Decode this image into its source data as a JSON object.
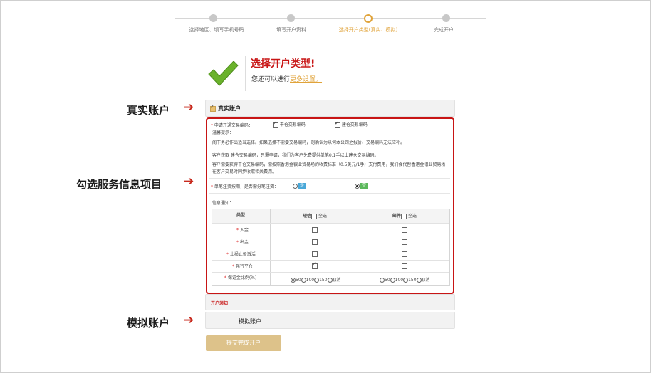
{
  "steps": [
    {
      "label": "选择地区、填写手机号码",
      "active": false
    },
    {
      "label": "填写开户资料",
      "active": false
    },
    {
      "label": "选择开户类型(真实、模拟)",
      "active": true
    },
    {
      "label": "完成开户",
      "active": false
    }
  ],
  "heading": {
    "title": "选择开户类型!",
    "subtitle_prefix": "您还可以进行",
    "subtitle_link": "更多设置。"
  },
  "side_labels": {
    "real": "真实账户",
    "services": "勾选服务信息项目",
    "demo": "模拟账户"
  },
  "real_account": {
    "label": "真实账户",
    "apply_label": "申请开通交易编码：",
    "codes": [
      {
        "label": "平仓交易编码",
        "checked": true
      },
      {
        "label": "建仓交易编码",
        "checked": true
      }
    ],
    "tips_title": "温馨提示：",
    "tips": [
      "阁下务必作出适当选择。如果选择不需要交易编码，则确认为以何本公司之报价、交易编码无法应补。",
      "客户获取 建仓交易编码，只需申请，我们为客户免费提供单笔0.1手以上建仓交易编码。",
      "客户需要获得平仓交易编码，需按照香港金银业贸易场的收费标准（0.5美元/1手）支付费用，我们会代替香港金银业贸易场在客户交易时同步收取相关费用。"
    ],
    "register_question": "单笔注资按期，是否需分笔注资：",
    "register_options": [
      {
        "label": "是",
        "selected": false,
        "color": "#4aa8d8"
      },
      {
        "label": "否",
        "selected": true,
        "color": "#5cb85c"
      }
    ]
  },
  "notification": {
    "title": "信息通知：",
    "headers": {
      "type": "类型",
      "sms": "短信",
      "sms_all": "全选",
      "email": "邮件",
      "email_all": "全选"
    },
    "rows": [
      {
        "label": "入金",
        "sms": false,
        "email": false
      },
      {
        "label": "出金",
        "sms": false,
        "email": false
      },
      {
        "label": "止损止盈激活",
        "sms": false,
        "email": false
      },
      {
        "label": "强行平仓",
        "sms": true,
        "email": false
      }
    ],
    "margin_row": {
      "label": "保证金比例(%)",
      "sms_options": [
        "50",
        "100",
        "150",
        "取消"
      ],
      "sms_selected": "50",
      "email_options": [
        "50",
        "100",
        "150",
        "取消"
      ],
      "email_selected": ""
    }
  },
  "open_notice": "开户须知",
  "demo_account": {
    "label": "模拟账户"
  },
  "submit_label": "提交完成开户",
  "colors": {
    "accent": "#e0a33a",
    "red": "#c81515",
    "submit": "#ddc28a"
  }
}
